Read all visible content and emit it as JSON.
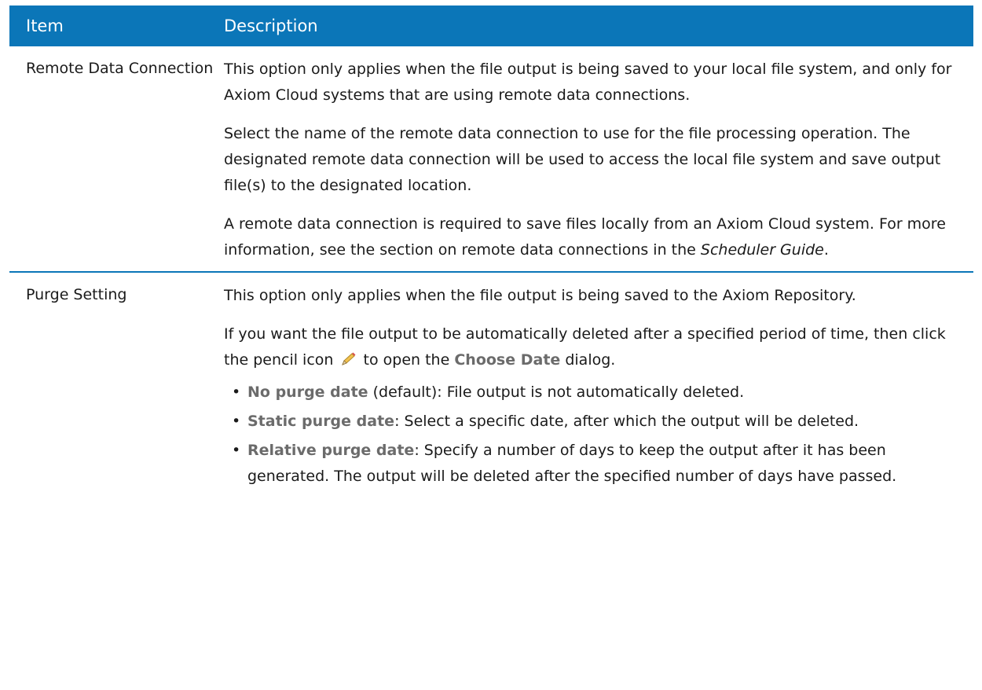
{
  "header": {
    "item": "Item",
    "description": "Description"
  },
  "rows": [
    {
      "item": "Remote Data Connection",
      "p1": "This option only applies when the file output is being saved to your local file system, and only for Axiom Cloud systems that are using remote data connections.",
      "p2": "Select the name of the remote data connection to use for the file processing operation. The designated remote data connection will be used to access the local file system and save output file(s) to the designated location.",
      "p3_a": "A remote data connection is required to save files locally from an Axiom Cloud system. For more information, see the section on remote data connections in the ",
      "p3_guide": "Scheduler Guide",
      "p3_b": "."
    },
    {
      "item": "Purge Setting",
      "p1": "This option only applies when the file output is being saved to the Axiom Repository.",
      "p2_a": "If you want the file output to be automatically deleted after a specified period of time, then click the pencil icon",
      "p2_b": " to open the ",
      "p2_dialog": "Choose Date",
      "p2_c": " dialog.",
      "icon": "pencil-icon",
      "bullets": [
        {
          "term": "No purge date",
          "text": " (default): File output is not automatically deleted."
        },
        {
          "term": "Static purge date",
          "text": ": Select a specific date, after which the output will be deleted."
        },
        {
          "term": "Relative purge date",
          "text": ": Specify a number of days to keep the output after it has been generated. The output will be deleted after the specified number of days have passed."
        }
      ]
    }
  ],
  "colors": {
    "header_bg": "#0b76b8",
    "term": "#6b6b6b",
    "text": "#1a1a1a"
  }
}
